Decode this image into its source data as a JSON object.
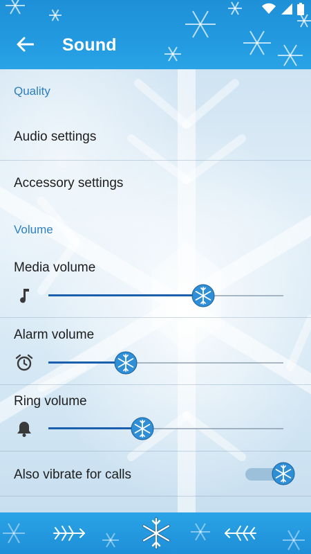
{
  "header": {
    "title": "Sound",
    "back_icon": "arrow-back-icon",
    "status_icons": [
      "wifi-icon",
      "signal-icon",
      "battery-icon"
    ]
  },
  "colors": {
    "topbar": "#1e90d8",
    "accent": "#2b7fc1",
    "slider_fill": "#1a5fae"
  },
  "sections": {
    "quality": {
      "header": "Quality",
      "items": [
        {
          "label": "Audio settings"
        },
        {
          "label": "Accessory settings"
        }
      ]
    },
    "volume": {
      "header": "Volume",
      "media": {
        "label": "Media volume",
        "icon": "music-note-icon",
        "level": 0.66
      },
      "alarm": {
        "label": "Alarm volume",
        "icon": "alarm-clock-icon",
        "level": 0.33
      },
      "ring": {
        "label": "Ring volume",
        "icon": "bell-icon",
        "level": 0.4
      },
      "vibrate": {
        "label": "Also vibrate for calls",
        "on": true
      }
    }
  },
  "nav": {
    "back_icon": "snowflake-back-icon",
    "home_icon": "snowflake-home-icon",
    "recent_icon": "snowflake-recent-icon"
  }
}
